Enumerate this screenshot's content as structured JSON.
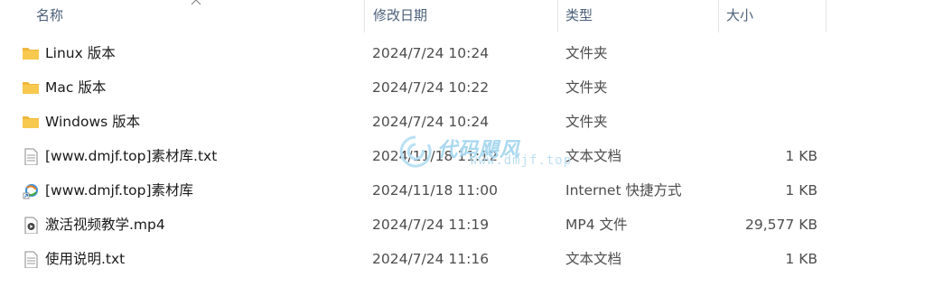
{
  "header": {
    "name_label": "名称",
    "date_label": "修改日期",
    "type_label": "类型",
    "size_label": "大小"
  },
  "files": [
    {
      "name": "Linux 版本",
      "date": "2024/7/24 10:24",
      "type": "文件夹",
      "size": "",
      "icon": "folder-icon"
    },
    {
      "name": "Mac 版本",
      "date": "2024/7/24 10:22",
      "type": "文件夹",
      "size": "",
      "icon": "folder-icon"
    },
    {
      "name": "Windows 版本",
      "date": "2024/7/24 10:24",
      "type": "文件夹",
      "size": "",
      "icon": "folder-icon"
    },
    {
      "name": "[www.dmjf.top]素材库.txt",
      "date": "2024/11/18 11:12",
      "type": "文本文档",
      "size": "1 KB",
      "icon": "text-file-icon"
    },
    {
      "name": "[www.dmjf.top]素材库",
      "date": "2024/11/18 11:00",
      "type": "Internet 快捷方式",
      "size": "1 KB",
      "icon": "internet-shortcut-icon"
    },
    {
      "name": "激活视频教学.mp4",
      "date": "2024/7/24 11:19",
      "type": "MP4 文件",
      "size": "29,577 KB",
      "icon": "video-file-icon"
    },
    {
      "name": "使用说明.txt",
      "date": "2024/7/24 11:16",
      "type": "文本文档",
      "size": "1 KB",
      "icon": "text-file-icon"
    }
  ],
  "watermark": {
    "title": "代码飓风",
    "url": "www.dmjf.top"
  },
  "colors": {
    "folder": "#f7c44a",
    "header_text": "#4c607a",
    "watermark": "#a9d8f0"
  }
}
